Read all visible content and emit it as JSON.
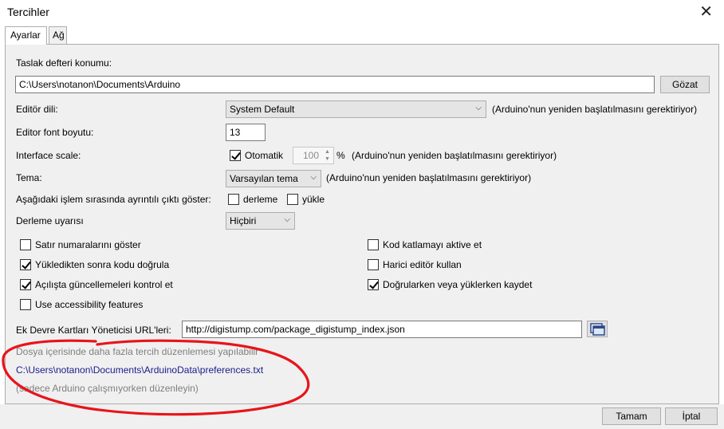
{
  "window": {
    "title": "Tercihler"
  },
  "tabs": [
    {
      "label": "Ayarlar"
    },
    {
      "label": "Ağ"
    }
  ],
  "sketchbook": {
    "label": "Taslak defteri konumu:",
    "value": "C:\\Users\\notanon\\Documents\\Arduino",
    "browse_label": "Gözat"
  },
  "editor_language": {
    "label": "Editör dili:",
    "value": "System Default",
    "note": "(Arduino'nun yeniden başlatılmasını gerektiriyor)"
  },
  "font_size": {
    "label": "Editor font boyutu:",
    "value": "13"
  },
  "interface_scale": {
    "label": "Interface scale:",
    "auto_label": "Otomatik",
    "value": "100",
    "unit": "%",
    "note": "(Arduino'nun yeniden başlatılmasını gerektiriyor)"
  },
  "theme": {
    "label": "Tema:",
    "value": "Varsayılan tema",
    "note": "(Arduino'nun yeniden başlatılmasını gerektiriyor)"
  },
  "verbose": {
    "label": "Aşağıdaki işlem sırasında ayrıntılı çıktı göster:",
    "compile_label": "derleme",
    "upload_label": "yükle"
  },
  "compiler_warnings": {
    "label": "Derleme uyarısı",
    "value": "Hiçbiri"
  },
  "checkboxes_left": [
    {
      "label": "Satır numaralarını göster",
      "checked": false
    },
    {
      "label": "Yükledikten sonra kodu doğrula",
      "checked": true
    },
    {
      "label": "Açılışta güncellemeleri kontrol et",
      "checked": true
    },
    {
      "label": "Use accessibility features",
      "checked": false
    }
  ],
  "checkboxes_right": [
    {
      "label": "Kod katlamayı aktive et",
      "checked": false
    },
    {
      "label": "Harici editör kullan",
      "checked": false
    },
    {
      "label": "Doğrularken veya yüklerken kaydet",
      "checked": true
    }
  ],
  "boards_url": {
    "label": "Ek Devre Kartları Yöneticisi URL'leri:",
    "value": "http://digistump.com/package_digistump_index.json"
  },
  "info": {
    "more_prefs": "Dosya içerisinde daha fazla tercih düzenlemesi yapılabilir",
    "prefs_path": "C:\\Users\\notanon\\Documents\\ArduinoData\\preferences.txt",
    "edit_note": "(sadece Arduino çalışmıyorken düzenleyin)"
  },
  "footer": {
    "ok_label": "Tamam",
    "cancel_label": "İptal"
  },
  "colors": {
    "annotation": "#e8141b",
    "panel": "#f0f0f0",
    "link": "#1a1a8c"
  }
}
